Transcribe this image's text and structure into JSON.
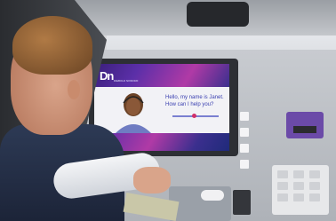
{
  "scene": {
    "description": "",
    "atm": {
      "logo_text": "Dn",
      "brand_text": "DIEBOLD NIXDORF",
      "greeting_line1": "Hello, my name is Janet.",
      "greeting_line2": "How can I help you?"
    }
  }
}
